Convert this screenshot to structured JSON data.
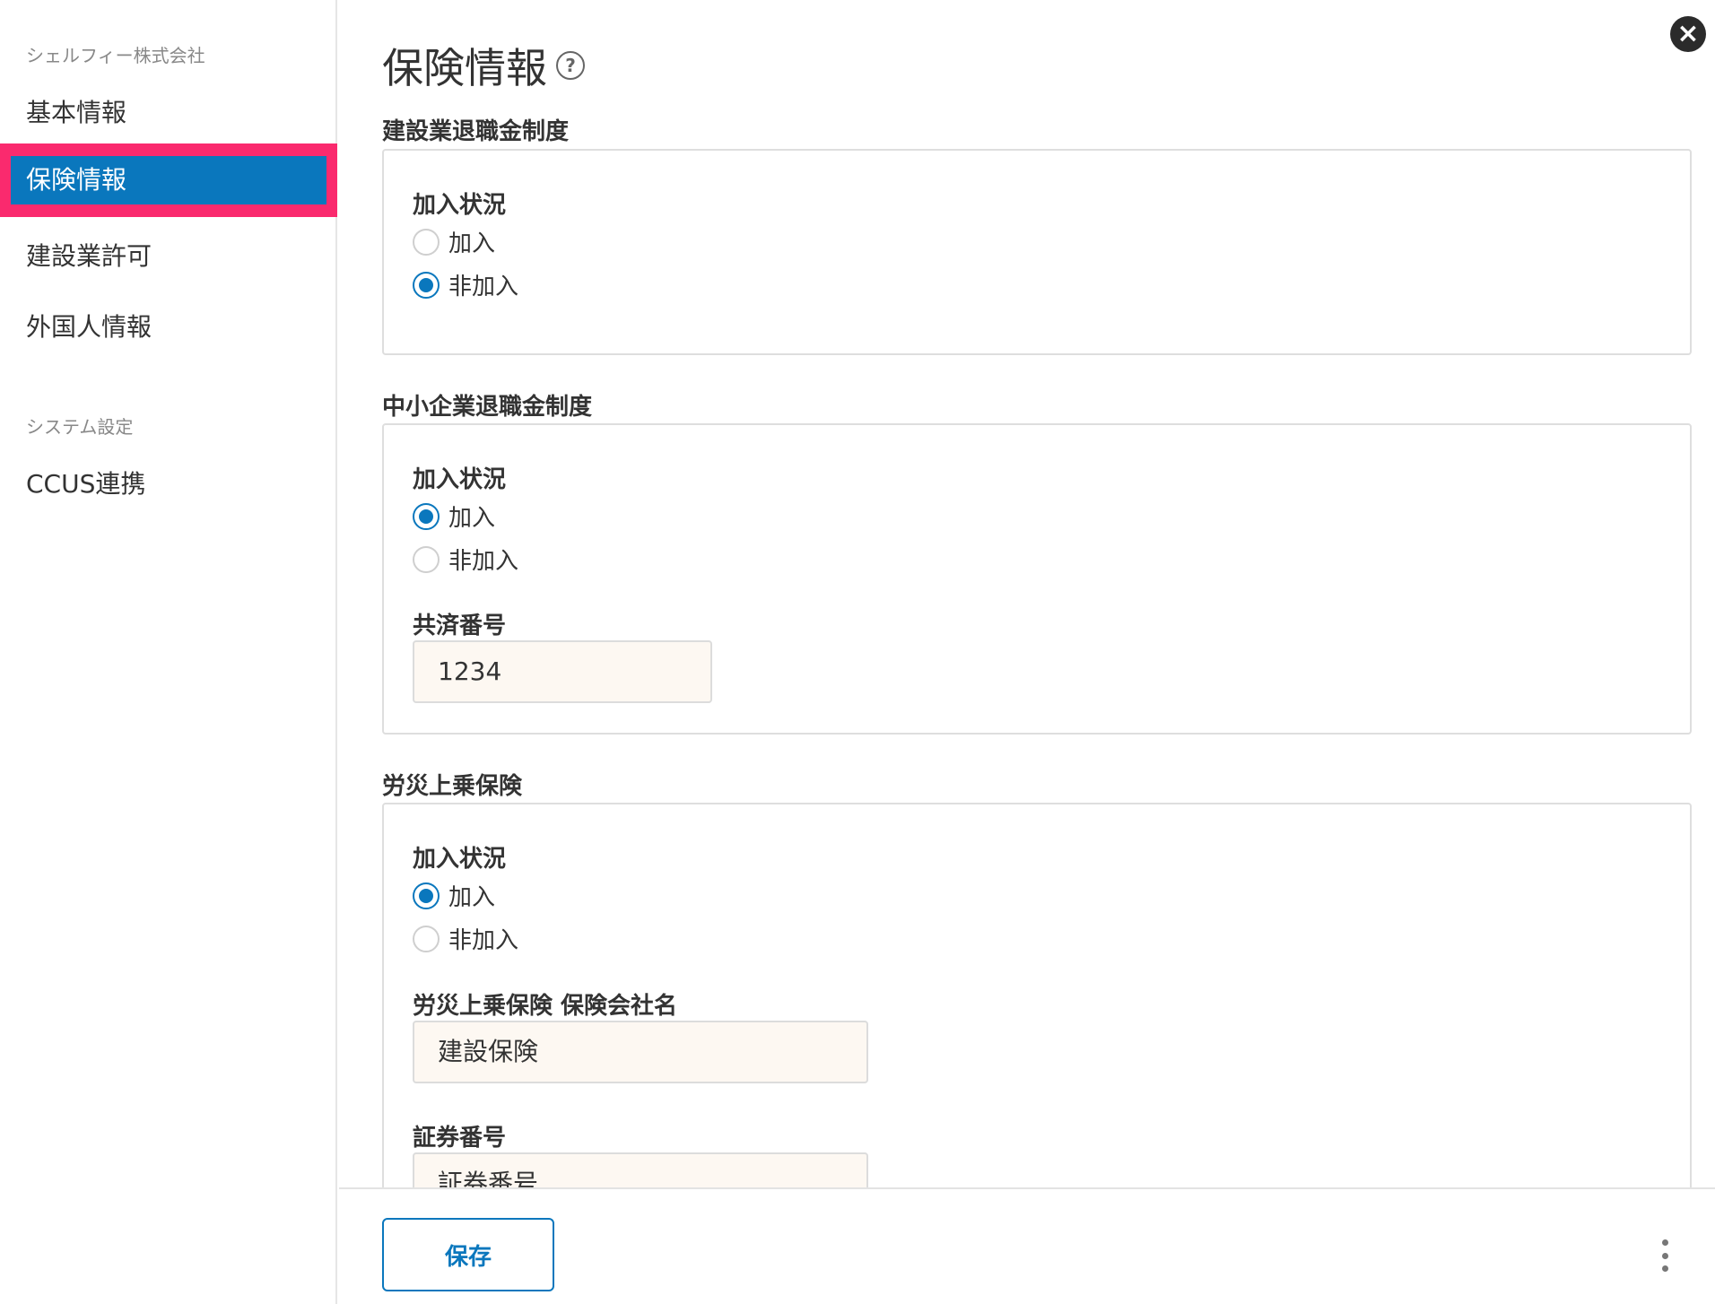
{
  "sidebar": {
    "company_label": "シェルフィー株式会社",
    "items": [
      {
        "label": "基本情報"
      },
      {
        "label": "保険情報"
      },
      {
        "label": "建設業許可"
      },
      {
        "label": "外国人情報"
      }
    ],
    "system_label": "システム設定",
    "system_items": [
      {
        "label": "CCUS連携"
      }
    ]
  },
  "page": {
    "title": "保険情報",
    "help_icon": "?",
    "close_icon": "×"
  },
  "sections": [
    {
      "title": "建設業退職金制度",
      "status_label": "加入状況",
      "options": [
        "加入",
        "非加入"
      ],
      "selected": "非加入"
    },
    {
      "title": "中小企業退職金制度",
      "status_label": "加入状況",
      "options": [
        "加入",
        "非加入"
      ],
      "selected": "加入",
      "field_label": "共済番号",
      "field_value": "1234"
    },
    {
      "title": "労災上乗保険",
      "status_label": "加入状況",
      "options": [
        "加入",
        "非加入"
      ],
      "selected": "加入",
      "field_label": "労災上乗保険 保険会社名",
      "field_value": "建設保険",
      "field2_label": "証券番号",
      "field2_placeholder": "証券番号"
    }
  ],
  "footer": {
    "save_label": "保存"
  },
  "colors": {
    "accent": "#0a77bd",
    "highlight": "#fa2a6e",
    "input_bg": "#fdf8f2"
  }
}
